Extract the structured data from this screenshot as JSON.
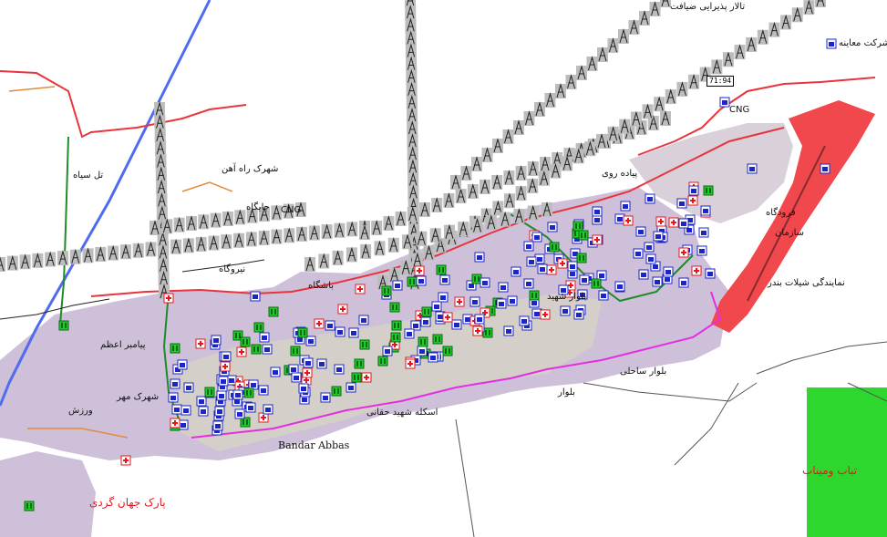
{
  "colors": {
    "background": "#ffffff",
    "urban_area": "#cfc0d9",
    "dense_area": "#d9d3c8",
    "airport": "#f0484c",
    "main_road": "#e8343c",
    "highway": "#4f6cf0",
    "park": "#2ed72e",
    "green_road": "#1f8a2a",
    "magenta_road": "#e52ee0",
    "orange_road": "#e38a3b",
    "tower": "#555555",
    "hospital": "#e8161c",
    "school": "#1e25c8",
    "bank": "#1ecc2a"
  },
  "icons": [
    "power-tower-icon",
    "school-icon",
    "hospital-icon",
    "bank-icon",
    "gas-station-icon",
    "mosque-icon"
  ],
  "labels": {
    "city": "Bandar Abbas",
    "cng_1": "CNG",
    "cng_2": "CNG",
    "highway_badge": "71:94",
    "park_label": "تباب ومیناب",
    "park_gardesh": "پارک جهان گردی",
    "pasdaran": "بلوار ساحلی",
    "airport": "نمایندگی شیلات بندر",
    "shahrak_rahahan": "شهرک راه آهن",
    "shahrak_mehr": "شهرک مهر",
    "tel_siah": "تل سیاه",
    "payam": "پیامبر اعظم",
    "fajr": "فرودگاه",
    "niroo": "نیروگاه",
    "sazman": "سازمان",
    "jaygah_cng": "جایگاه",
    "isgah": "اسکله شهید حقانی",
    "bandar_text": "باشگاه",
    "borz": "ورزش",
    "coast_road": "بلوار",
    "top_label": "تالار پذیرایی ضیافت",
    "top_label2": "شرکت معاینه",
    "piade": "پیاده روی",
    "shahid": "بلوار شهید"
  }
}
